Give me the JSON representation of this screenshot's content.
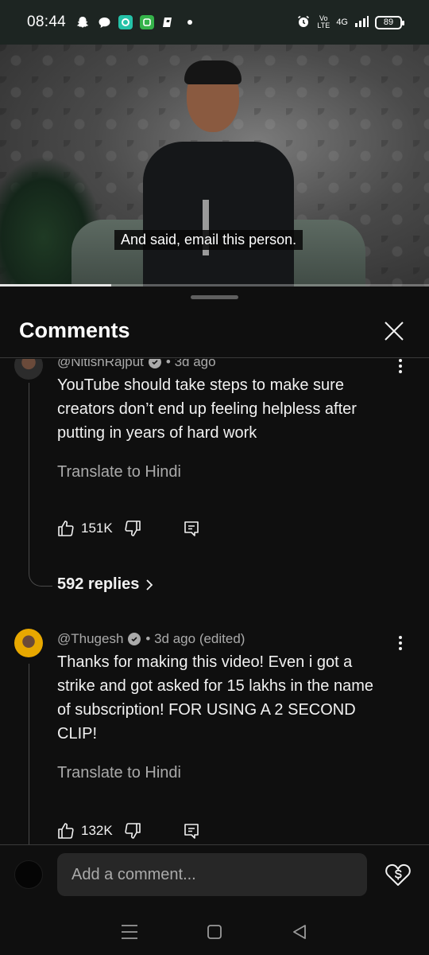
{
  "status_bar": {
    "time": "08:44",
    "left_icons": [
      "snapchat-icon",
      "chat-bubble-icon",
      "app-icon-teal",
      "app-icon-green",
      "app-icon-b",
      "dot-icon"
    ],
    "network": "4G",
    "volte": "Vo LTE",
    "battery": "89"
  },
  "video": {
    "caption": "And said, email this person.",
    "progress": 0.26
  },
  "sheet": {
    "title": "Comments"
  },
  "comments": [
    {
      "author": "@NitishRajput",
      "verified": true,
      "time": "• 3d ago",
      "text": "YouTube should take steps to make sure creators don’t end up feeling helpless after putting in years of hard work",
      "translate": "Translate to Hindi",
      "likes": "151K",
      "replies": "592 replies"
    },
    {
      "author": "@Thugesh",
      "verified": true,
      "time": "• 3d ago (edited)",
      "text": "Thanks for making this video! Even i got a strike and got asked for 15 lakhs in the name of subscription! FOR USING A 2 SECOND CLIP!",
      "translate": "Translate to Hindi",
      "likes": "132K"
    }
  ],
  "add_comment": {
    "placeholder": "Add a comment..."
  },
  "colors": {
    "background": "#0f0f0f",
    "status_bar": "#1d2522",
    "text_secondary": "#aaaaaa",
    "input_bg": "#272727"
  }
}
